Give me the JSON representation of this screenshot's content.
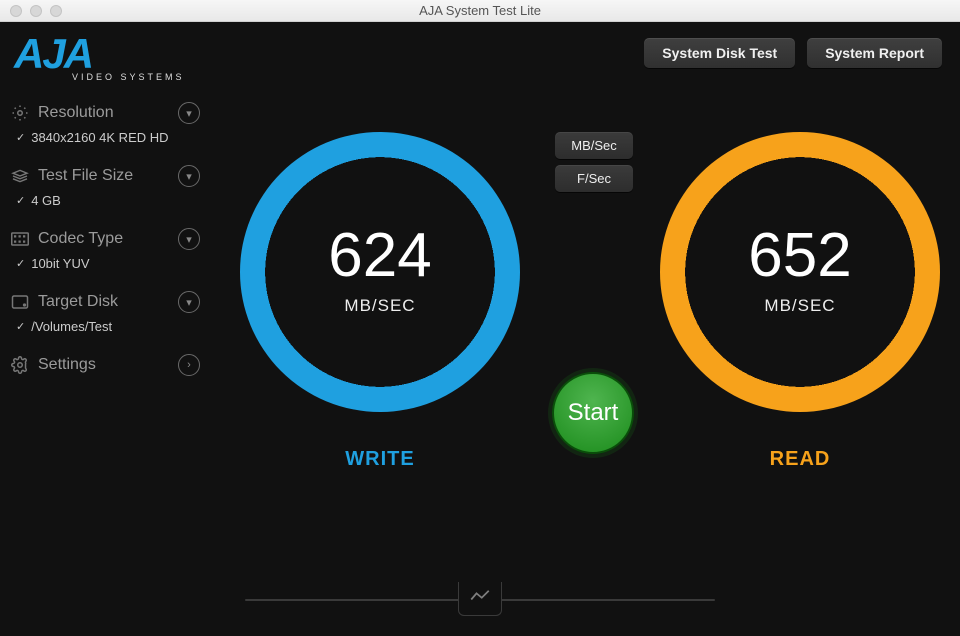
{
  "window": {
    "title": "AJA System Test Lite"
  },
  "brand": {
    "name": "AJA",
    "subtitle": "VIDEO SYSTEMS"
  },
  "header": {
    "disk_test": "System Disk Test",
    "system_report": "System Report"
  },
  "sidebar": {
    "items": [
      {
        "label": "Resolution",
        "value": "3840x2160 4K RED HD",
        "arrow": "down"
      },
      {
        "label": "Test File Size",
        "value": "4 GB",
        "arrow": "down"
      },
      {
        "label": "Codec Type",
        "value": "10bit YUV",
        "arrow": "down"
      },
      {
        "label": "Target Disk",
        "value": "/Volumes/Test",
        "arrow": "down"
      },
      {
        "label": "Settings",
        "value": null,
        "arrow": "right"
      }
    ]
  },
  "units": {
    "mbsec": "MB/Sec",
    "fsec": "F/Sec"
  },
  "start_label": "Start",
  "write": {
    "value": "624",
    "unit": "MB/SEC",
    "label": "WRITE",
    "color": "#1fa0e0"
  },
  "read": {
    "value": "652",
    "unit": "MB/SEC",
    "label": "READ",
    "color": "#f7a21b"
  }
}
